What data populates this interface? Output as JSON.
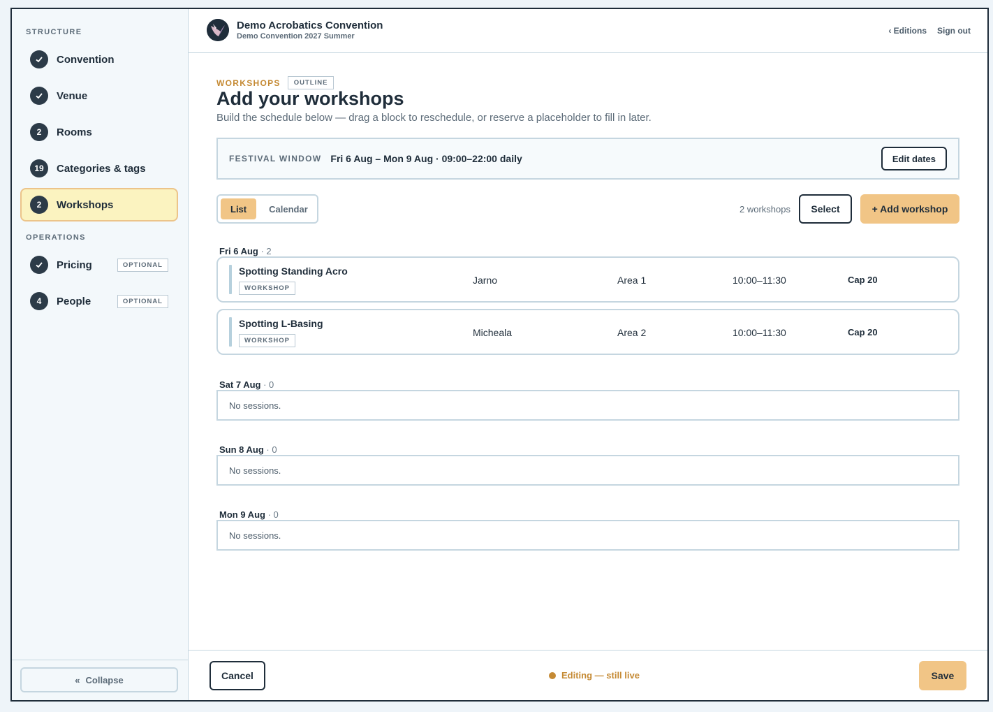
{
  "sidebar": {
    "structure_label": "STRUCTURE",
    "operations_label": "OPERATIONS",
    "items": [
      {
        "label": "Convention",
        "badge": "check"
      },
      {
        "label": "Venue",
        "badge": "check"
      },
      {
        "label": "Rooms",
        "badge": "2"
      },
      {
        "label": "Categories & tags",
        "badge": "19"
      },
      {
        "label": "Workshops",
        "badge": "2",
        "active": true
      }
    ],
    "operations": [
      {
        "label": "Pricing",
        "badge": "check",
        "tag": "OPTIONAL"
      },
      {
        "label": "People",
        "badge": "4",
        "tag": "OPTIONAL"
      }
    ],
    "collapse_icon": "«",
    "collapse_label": "Collapse"
  },
  "header": {
    "title": "Demo Acrobatics Convention",
    "subtitle": "Demo Convention 2027 Summer",
    "editions_link": "‹ Editions",
    "signout_link": "Sign out"
  },
  "page": {
    "eyebrow": "WORKSHOPS",
    "eyebrow_tag": "OUTLINE",
    "title": "Add your workshops",
    "description": "Build the schedule below — drag a block to reschedule, or reserve a placeholder to fill in later."
  },
  "festival_window": {
    "label": "FESTIVAL WINDOW",
    "value": "Fri 6 Aug – Mon 9 Aug · 09:00–22:00 daily",
    "edit_button": "Edit dates"
  },
  "toolbar": {
    "view_list": "List",
    "view_calendar": "Calendar",
    "count": "2 workshops",
    "select_button": "Select",
    "add_button": "+ Add workshop"
  },
  "days": [
    {
      "label": "Fri 6 Aug",
      "count": " · 2",
      "workshops": [
        {
          "name": "Spotting Standing Acro",
          "type": "WORKSHOP",
          "teacher": "Jarno",
          "room": "Area 1",
          "time": "10:00–11:30",
          "capacity": "Cap 20"
        },
        {
          "name": "Spotting L-Basing",
          "type": "WORKSHOP",
          "teacher": "Micheala",
          "room": "Area 2",
          "time": "10:00–11:30",
          "capacity": "Cap 20"
        }
      ]
    },
    {
      "label": "Sat 7 Aug",
      "count": " · 0",
      "empty": "No sessions."
    },
    {
      "label": "Sun 8 Aug",
      "count": " · 0",
      "empty": "No sessions."
    },
    {
      "label": "Mon 9 Aug",
      "count": " · 0",
      "empty": "No sessions."
    }
  ],
  "footer": {
    "cancel": "Cancel",
    "status": "Editing — still live",
    "save": "Save"
  },
  "colors": {
    "accent": "#f1c586",
    "accent_text": "#c58a34",
    "dark": "#1f2d3a",
    "border": "#c5d6e0"
  }
}
